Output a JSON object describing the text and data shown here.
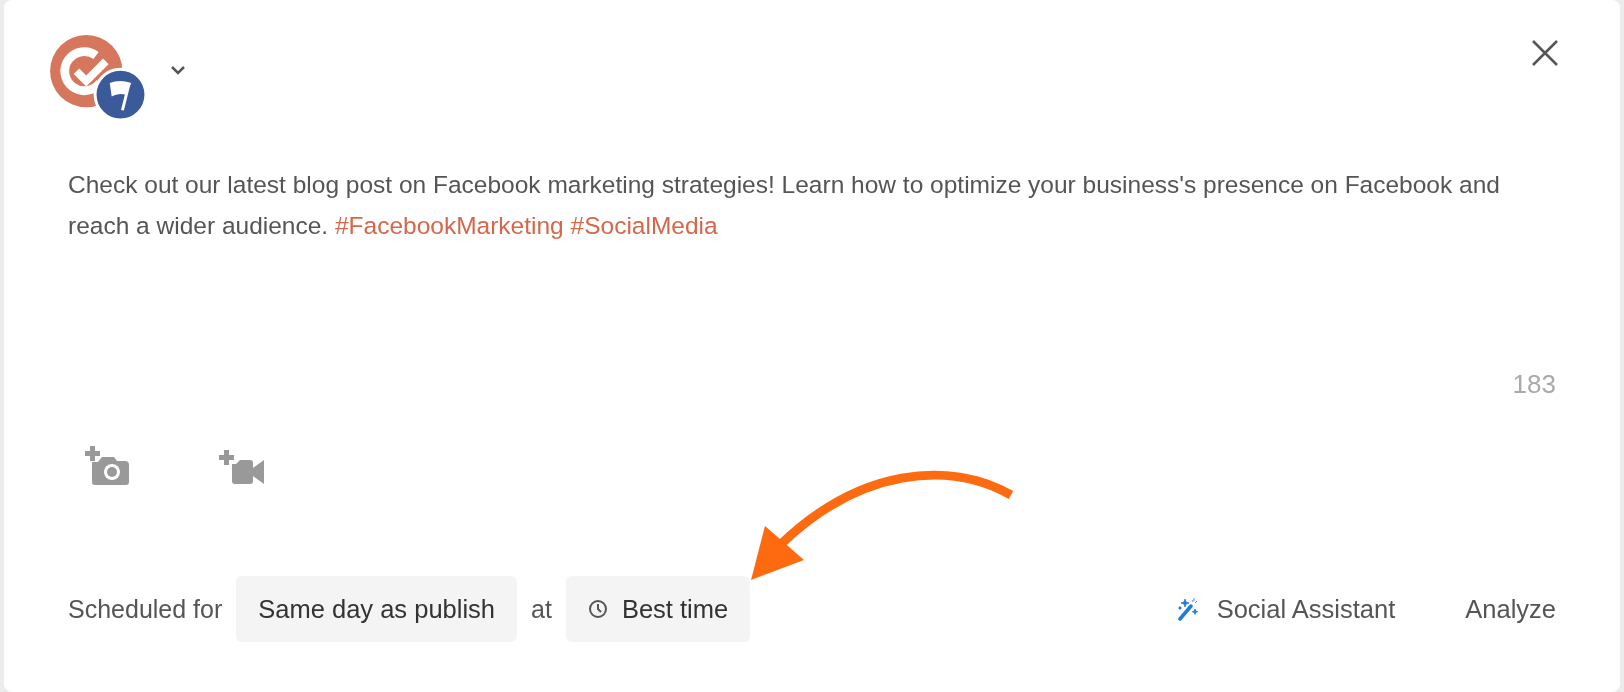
{
  "post": {
    "segments": [
      {
        "kind": "text",
        "text": "Check out our latest blog post on Facebook marketing strategies! Learn how to optimize your business's presence on Facebook and reach a wider audience. "
      },
      {
        "kind": "hashtag",
        "text": "#FacebookMarketing"
      },
      {
        "kind": "hashtag",
        "text": "#SocialMedia"
      }
    ],
    "character_count": "183"
  },
  "schedule": {
    "label": "Scheduled for",
    "day": "Same day as publish",
    "connector": "at",
    "time": "Best time"
  },
  "actions": [
    {
      "kind": "assistant",
      "label": "Social Assistant"
    },
    {
      "kind": "plain",
      "label": "Analyze"
    }
  ]
}
